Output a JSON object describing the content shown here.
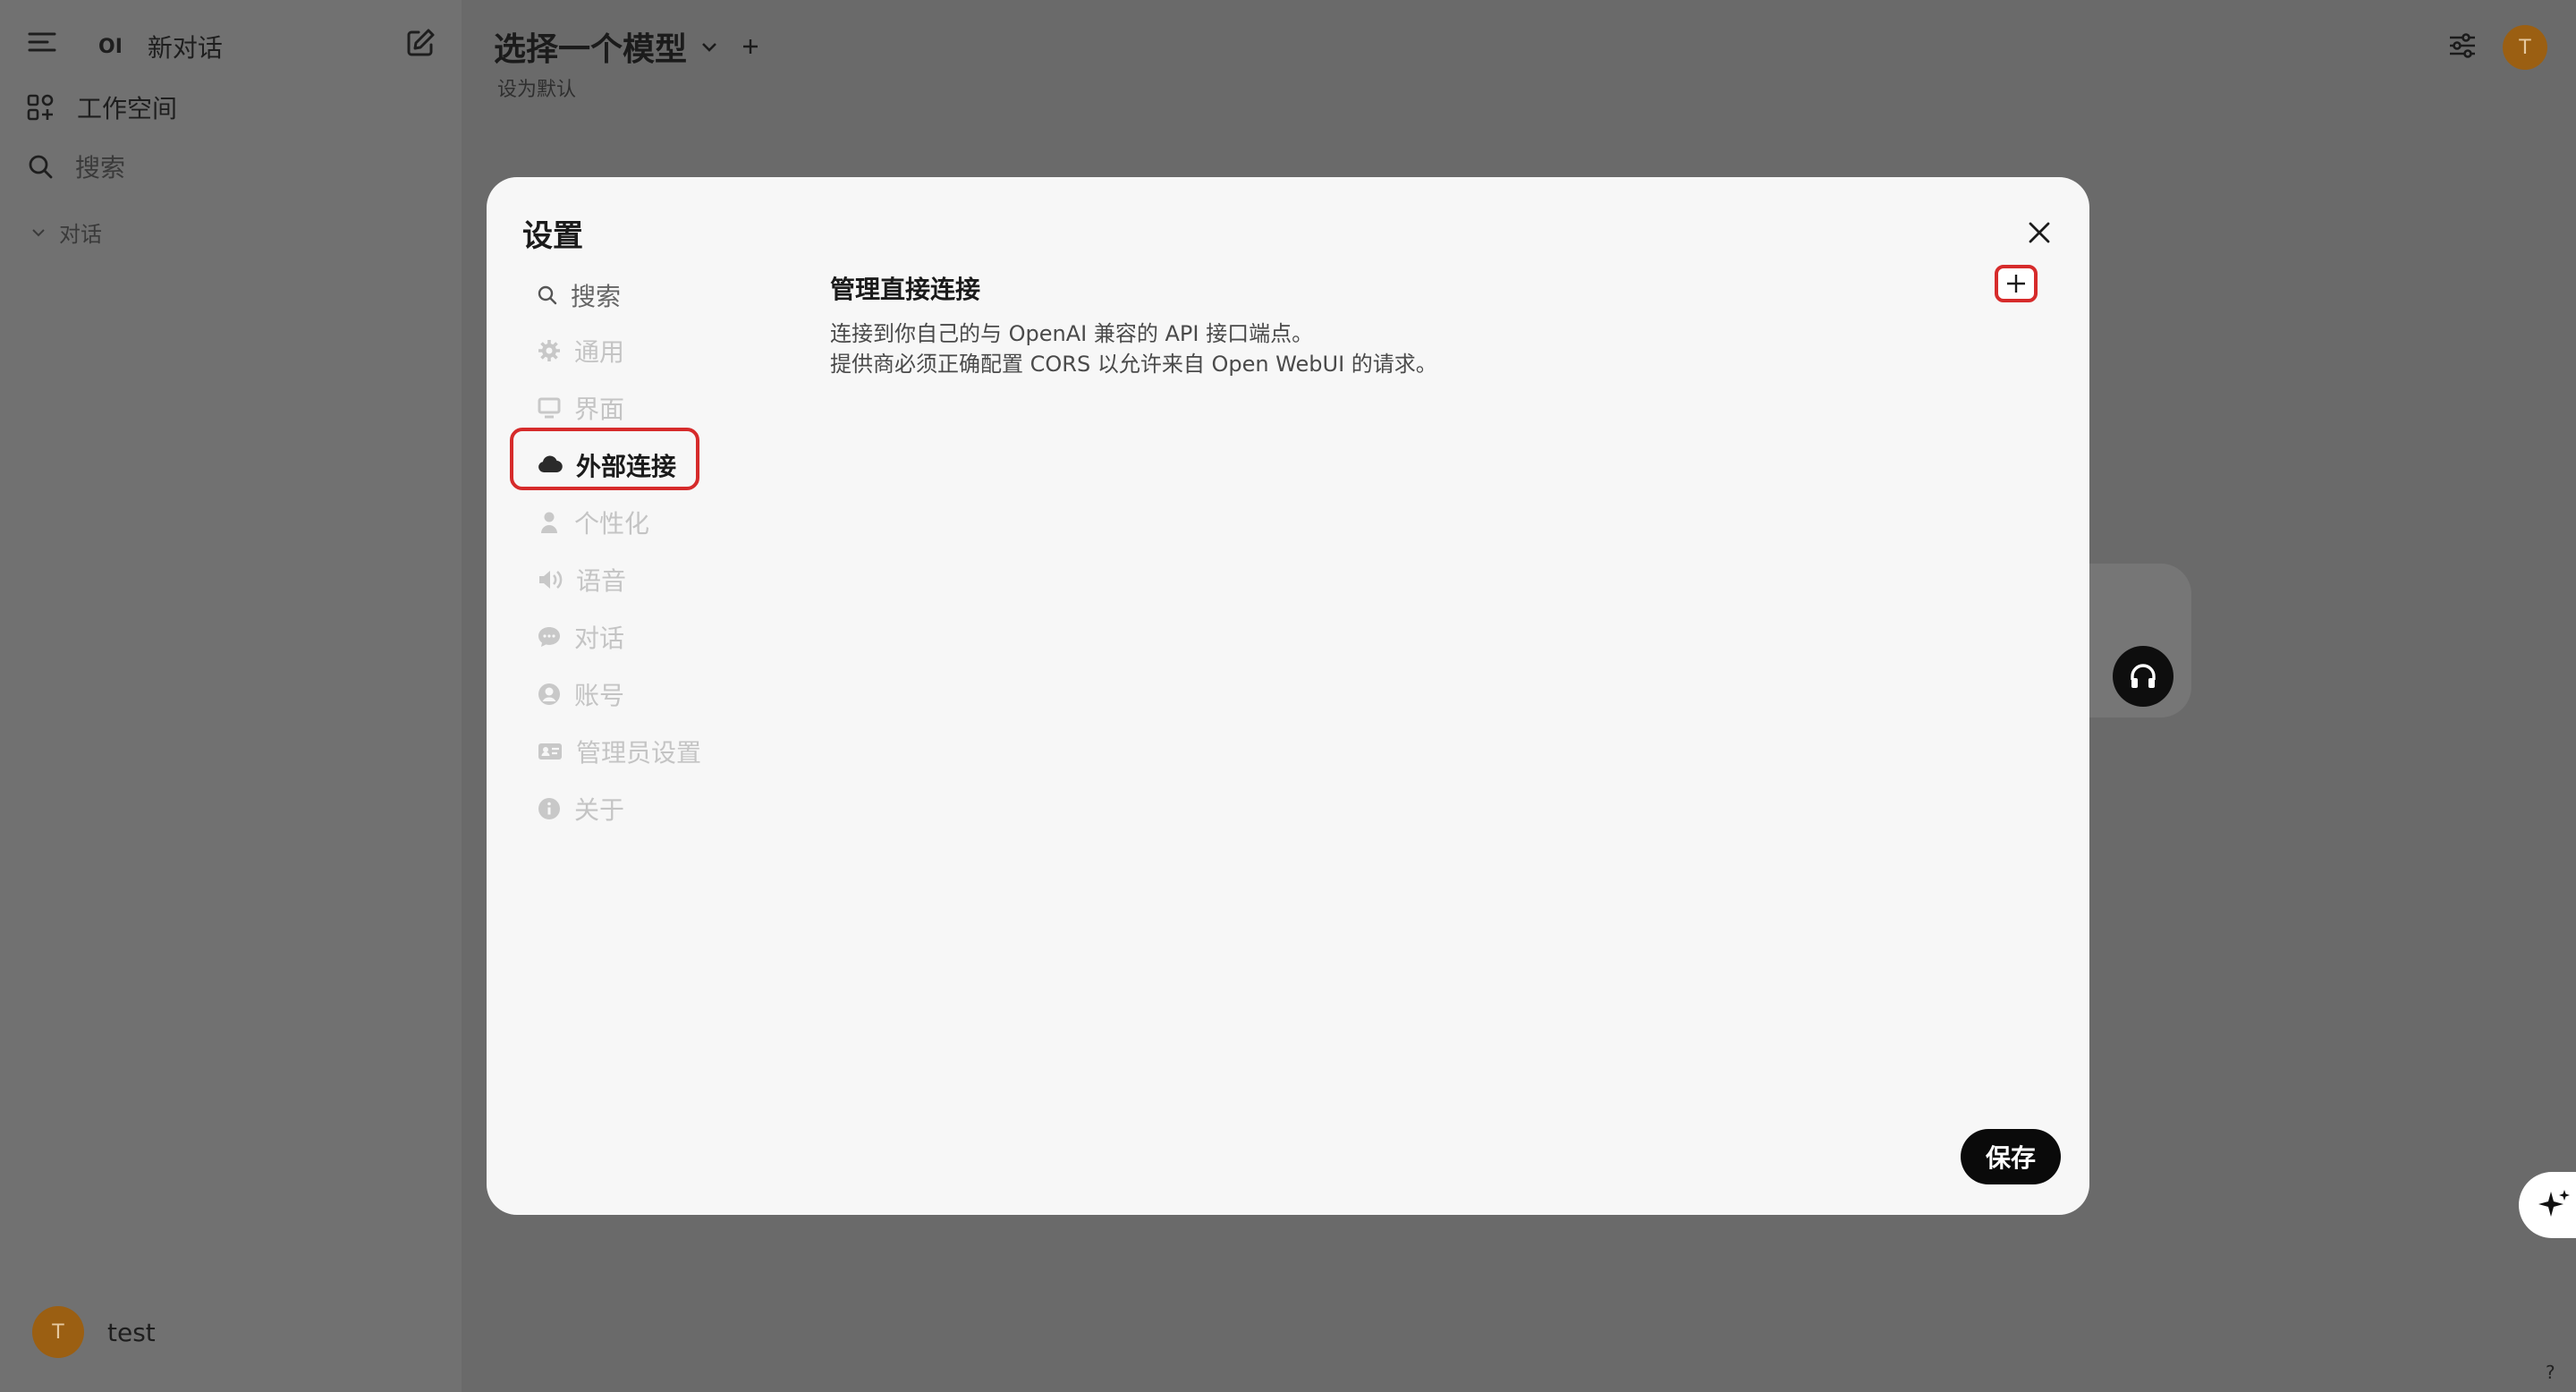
{
  "sidebar": {
    "brand": "OI",
    "new_chat": "新对话",
    "workspace": "工作空间",
    "search": "搜索",
    "section": "对话",
    "user": {
      "name": "test",
      "initial": "T"
    }
  },
  "header": {
    "model_select": "选择一个模型",
    "set_default": "设为默认",
    "avatar_initial": "T"
  },
  "modal": {
    "title": "设置",
    "nav": [
      {
        "label": "搜索",
        "icon": "search-icon"
      },
      {
        "label": "通用",
        "icon": "gear-icon"
      },
      {
        "label": "界面",
        "icon": "monitor-icon"
      },
      {
        "label": "外部连接",
        "icon": "cloud-icon",
        "active": true
      },
      {
        "label": "个性化",
        "icon": "person-icon"
      },
      {
        "label": "语音",
        "icon": "speaker-icon"
      },
      {
        "label": "对话",
        "icon": "chat-bubble-icon"
      },
      {
        "label": "账号",
        "icon": "user-circle-icon"
      },
      {
        "label": "管理员设置",
        "icon": "id-card-icon"
      },
      {
        "label": "关于",
        "icon": "info-icon"
      }
    ],
    "panel": {
      "title": "管理直接连接",
      "desc_line1": "连接到你自己的与 OpenAI 兼容的 API 接口端点。",
      "desc_line2": "提供商必须正确配置 CORS 以允许来自 Open WebUI 的请求。"
    },
    "save_label": "保存"
  },
  "misc": {
    "help": "?"
  },
  "colors": {
    "highlight": "#d62b2b",
    "avatar": "#9b5f12",
    "primary_button": "#0a0a0a"
  }
}
